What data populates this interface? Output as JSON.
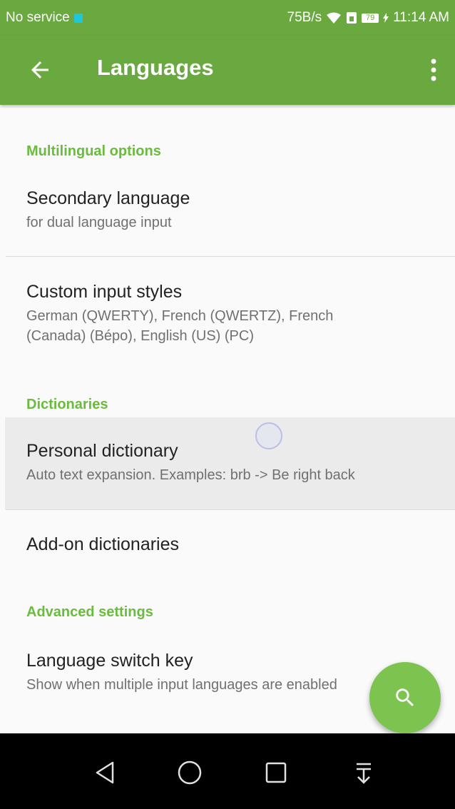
{
  "status_bar": {
    "carrier": "No service",
    "speed": "75B/s",
    "battery": "79",
    "time": "11:14 AM"
  },
  "app_bar": {
    "title": "Languages"
  },
  "sections": {
    "multilingual": "Multilingual options",
    "dictionaries": "Dictionaries",
    "advanced": "Advanced settings"
  },
  "prefs": {
    "secondary_language": {
      "title": "Secondary language",
      "summary": "for dual language input"
    },
    "custom_input_styles": {
      "title": "Custom input styles",
      "summary": "German (QWERTY), French (QWERTZ), French (Canada) (Bépo), English (US) (PC)"
    },
    "personal_dictionary": {
      "title": "Personal dictionary",
      "summary": "Auto text expansion. Examples: brb -> Be right back"
    },
    "addon_dictionaries": {
      "title": "Add-on dictionaries"
    },
    "language_switch_key": {
      "title": "Language switch key",
      "summary": "Show when multiple input languages are enabled"
    }
  },
  "icons": {
    "back": "arrow-back-icon",
    "overflow": "more-vert-icon",
    "fab": "search-icon",
    "nav_back": "triangle-back-icon",
    "nav_home": "circle-home-icon",
    "nav_recents": "square-recents-icon",
    "nav_notifications": "pull-down-icon"
  },
  "colors": {
    "primary": "#6aa840",
    "accent": "#6bbb3e",
    "fab": "#7cc44f"
  }
}
